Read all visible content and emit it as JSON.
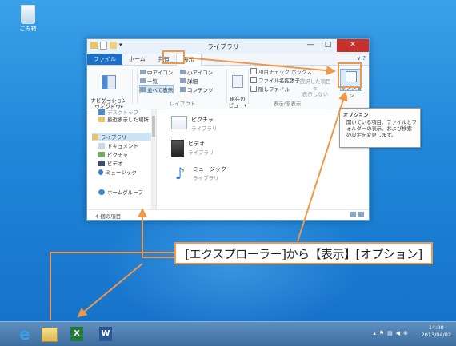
{
  "desktop": {
    "recycle_bin_label": "ごみ箱"
  },
  "window": {
    "title": "ライブラリ",
    "caption": {
      "minimize": "—",
      "maximize": "□",
      "close": "✕"
    },
    "tabs": [
      "ファイル",
      "ホーム",
      "共有",
      "表示"
    ],
    "help": "∨ ?",
    "ribbon": {
      "nav_pane": "ナビゲーション\nウィンドウ▾",
      "pane_group": "ペイン",
      "layout": {
        "medium_icons": "中アイコン",
        "small_icons": "小アイコン",
        "list": "一覧",
        "details": "詳細",
        "tiles": "並べて表示",
        "content": "コンテンツ",
        "group_label": "レイアウト"
      },
      "current_view": "現在の\nビュー▾",
      "show_hide": {
        "item_checkbox": "項目チェック ボックス",
        "extensions": "ファイル名拡張子",
        "hidden": "隠しファイル",
        "hide_selected": "選択した項目を\n表示しない",
        "group_label": "表示/非表示"
      },
      "options": "オプション"
    },
    "nav": {
      "favorites_cut": "デスクトップ",
      "recent": "最近表示した場所",
      "libraries": "ライブラリ",
      "documents": "ドキュメント",
      "pictures": "ピクチャ",
      "videos": "ビデオ",
      "music": "ミュージック",
      "homegroup": "ホームグループ"
    },
    "libraries": [
      {
        "name": "ピクチャ",
        "sub": "ライブラリ"
      },
      {
        "name": "ビデオ",
        "sub": "ライブラリ"
      },
      {
        "name": "ミュージック",
        "sub": "ライブラリ"
      }
    ],
    "status": "4 個の項目"
  },
  "tooltip": {
    "title": "オプション",
    "body": "開いている項目、ファイルとフォルダーの表示、および検索の設定を変更します。"
  },
  "callout": "[エクスプローラー]から【表示】[オプション]",
  "taskbar": {
    "time": "14:00",
    "date": "2013/04/02"
  },
  "colors": {
    "highlight": "#f0984a",
    "accent": "#1b6fc8"
  }
}
